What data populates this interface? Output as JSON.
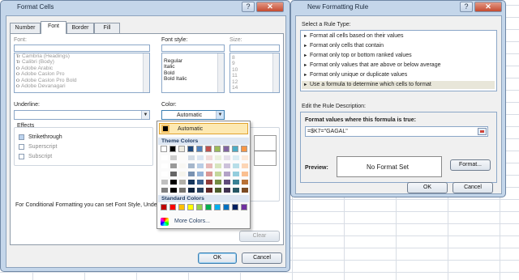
{
  "format_cells": {
    "title": "Format Cells",
    "tabs": [
      "Number",
      "Font",
      "Border",
      "Fill"
    ],
    "font_label": "Font:",
    "font_style_label": "Font style:",
    "size_label": "Size:",
    "fonts": [
      "Cambria (Headings)",
      "Calibri (Body)",
      "Adobe Arabic",
      "Adobe Caslon Pro",
      "Adobe Caslon Pro Bold",
      "Adobe Devanagari"
    ],
    "font_styles": [
      "Regular",
      "Italic",
      "Bold",
      "Bold Italic"
    ],
    "sizes": [
      "8",
      "9",
      "10",
      "11",
      "12",
      "14"
    ],
    "underline_label": "Underline:",
    "color_label": "Color:",
    "color_value": "Automatic",
    "effects_label": "Effects",
    "effects": [
      "Strikethrough",
      "Superscript",
      "Subscript"
    ],
    "note": "For Conditional Formatting you can set Font Style, Unde",
    "clear_label": "Clear",
    "ok_label": "OK",
    "cancel_label": "Cancel"
  },
  "color_popup": {
    "automatic_label": "Automatic",
    "theme_label": "Theme Colors",
    "standard_label": "Standard Colors",
    "more_label": "More Colors...",
    "theme_colors": [
      "#ffffff",
      "#000000",
      "#eeece1",
      "#1f497d",
      "#4f81bd",
      "#c0504d",
      "#9bbb59",
      "#8064a2",
      "#4bacc6",
      "#f79646"
    ],
    "standard_colors": [
      "#c00000",
      "#ff0000",
      "#ffc000",
      "#ffff00",
      "#92d050",
      "#00b050",
      "#00b0f0",
      "#0070c0",
      "#002060",
      "#7030a0"
    ]
  },
  "new_rule": {
    "title": "New Formatting Rule",
    "select_label": "Select a Rule Type:",
    "rule_types": [
      "Format all cells based on their values",
      "Format only cells that contain",
      "Format only top or bottom ranked values",
      "Format only values that are above or below average",
      "Format only unique or duplicate values",
      "Use a formula to determine which cells to format"
    ],
    "edit_label": "Edit the Rule Description:",
    "formula_label": "Format values where this formula is true:",
    "formula_value": "=$K7=\"GAGAL\"",
    "preview_label": "Preview:",
    "preview_text": "No Format Set",
    "format_button": "Format...",
    "ok_label": "OK",
    "cancel_label": "Cancel"
  }
}
